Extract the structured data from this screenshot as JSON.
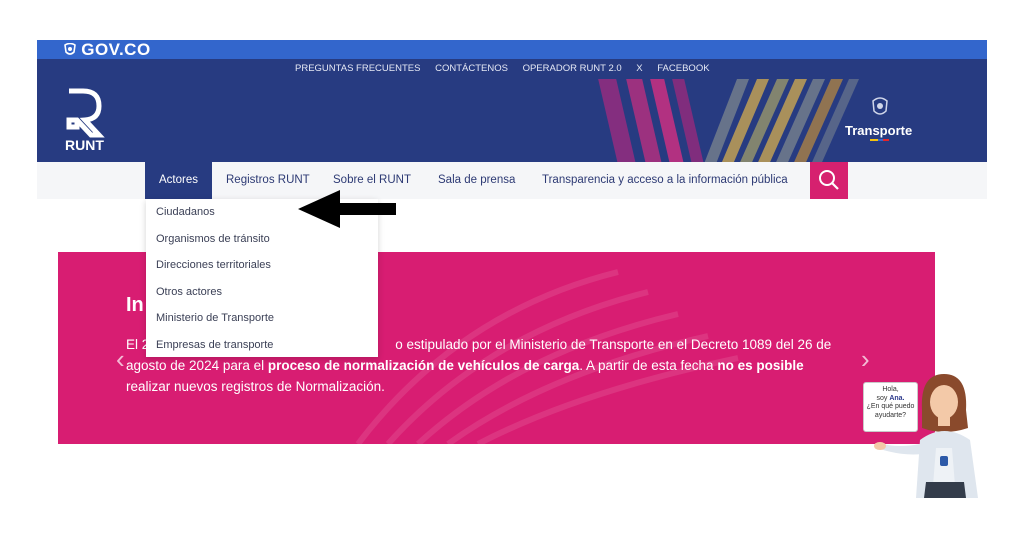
{
  "gov_bar": {
    "logo_text": "GOV.CO"
  },
  "top_links": [
    "PREGUNTAS FRECUENTES",
    "CONTÁCTENOS",
    "OPERADOR RUNT 2.0",
    "X",
    "FACEBOOK"
  ],
  "header": {
    "brand": "RUNT",
    "ministry": "Transporte"
  },
  "nav": {
    "items": [
      "Actores",
      "Registros RUNT",
      "Sobre el RUNT",
      "Sala de prensa",
      "Transparencia y acceso a la información pública"
    ],
    "active": "Actores"
  },
  "dropdown": {
    "items": [
      "Ciudadanos",
      "Organismos de tránsito",
      "Direcciones territoriales",
      "Otros actores",
      "Ministerio de Transporte",
      "Empresas de transporte"
    ]
  },
  "banner": {
    "title_fragment": "In",
    "line1_prefix": "El 2",
    "line1_suffix": "o estipulado por el Ministerio de Transporte en el Decreto 1089 del 26 de",
    "line2_prefix": "agosto de 2024 para el ",
    "line2_bold": "proceso de normalización de vehículos de carga",
    "line2_mid": ". A partir de esta fecha ",
    "line2_bold2": "no es posible",
    "line3": "realizar nuevos registros de Normalización."
  },
  "assistant": {
    "line1": "Hola,",
    "line2_pre": "soy ",
    "line2_name": "Ana.",
    "line3": "¿En qué puedo",
    "line4": "ayudarte?"
  },
  "colors": {
    "gov_blue": "#3366cc",
    "navy": "#273b81",
    "magenta": "#d81d72",
    "search": "#d6216f"
  }
}
